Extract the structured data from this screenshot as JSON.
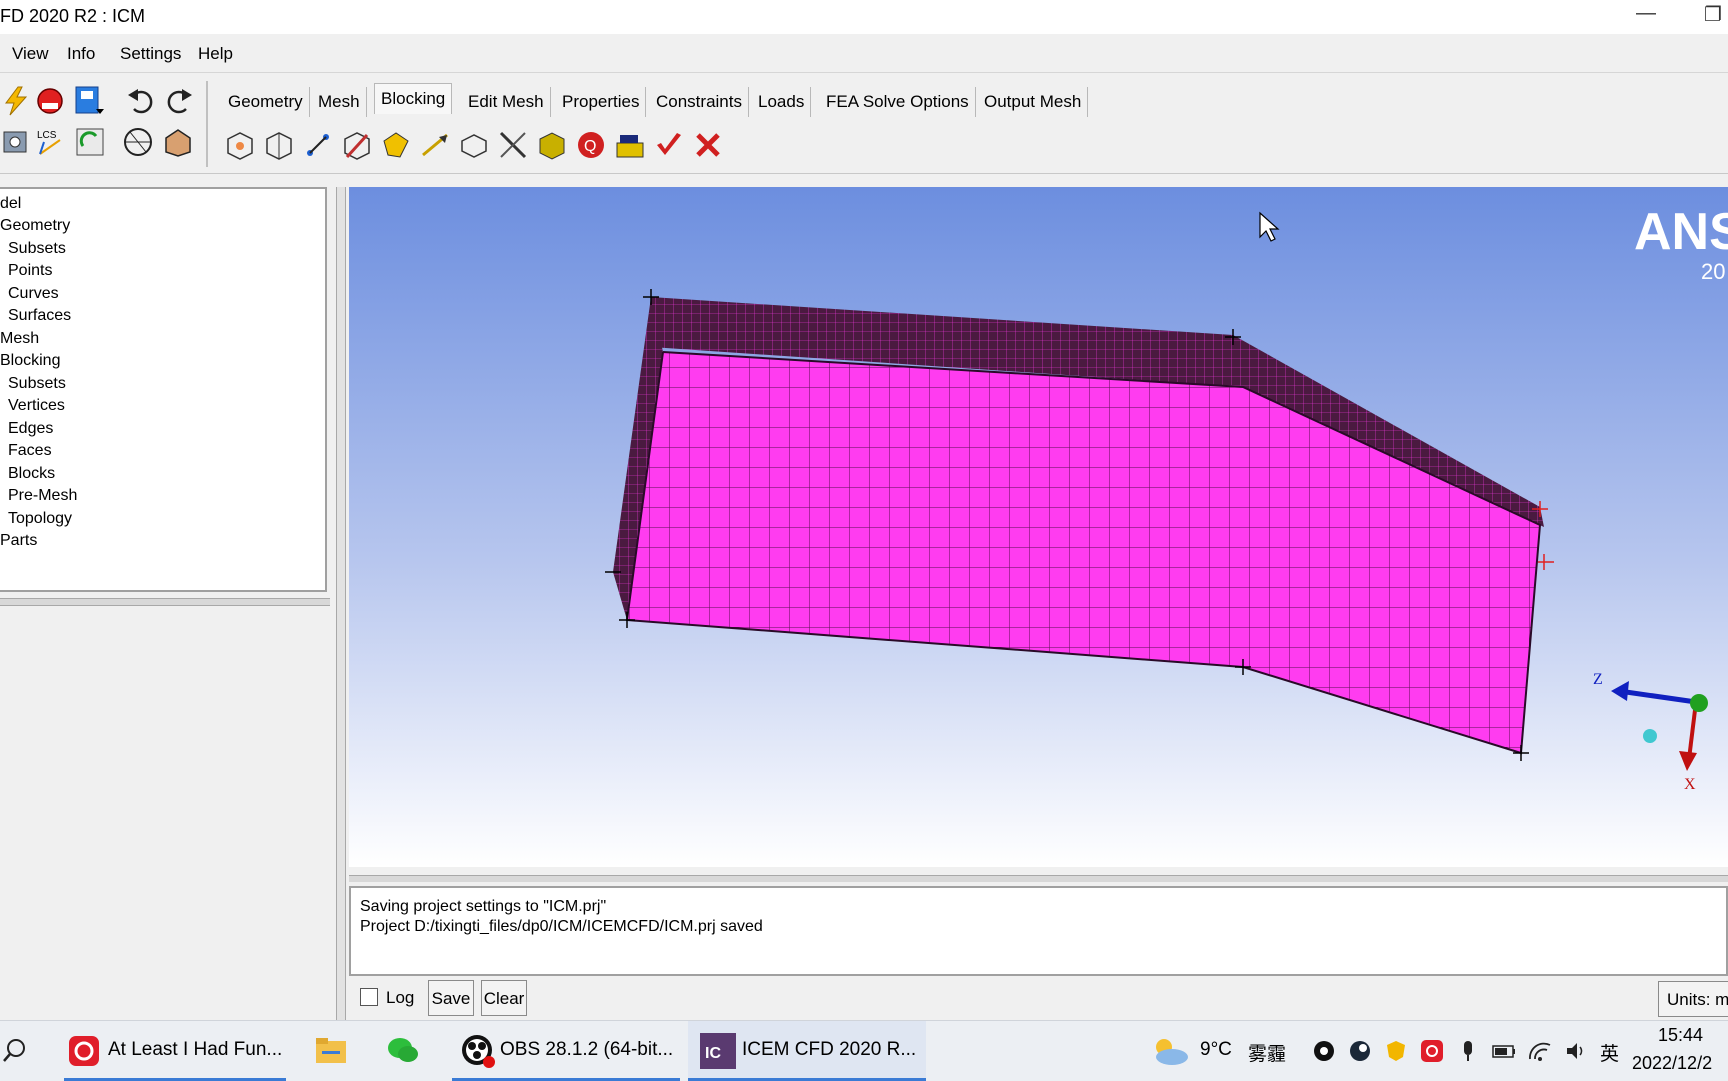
{
  "window": {
    "title": "FD 2020 R2 : ICM"
  },
  "menu": [
    "View",
    "Info",
    "Settings",
    "Help"
  ],
  "tabs": [
    {
      "label": "Geometry",
      "active": false
    },
    {
      "label": "Mesh",
      "active": false
    },
    {
      "label": "Blocking",
      "active": true
    },
    {
      "label": "Edit Mesh",
      "active": false
    },
    {
      "label": "Properties",
      "active": false
    },
    {
      "label": "Constraints",
      "active": false
    },
    {
      "label": "Loads",
      "active": false
    },
    {
      "label": "FEA Solve Options",
      "active": false
    },
    {
      "label": "Output Mesh",
      "active": false
    }
  ],
  "tree": [
    "del",
    "Geometry",
    "Subsets",
    "Points",
    "Curves",
    "Surfaces",
    "Mesh",
    "Blocking",
    "Subsets",
    "Vertices",
    "Edges",
    "Faces",
    "Blocks",
    "Pre-Mesh",
    "Topology",
    "Parts"
  ],
  "viewport": {
    "logo": "ANS",
    "logo_year": "20",
    "axis_labels": {
      "z": "Z",
      "x": "X"
    },
    "colors": {
      "mesh_face": "#ff3cf0",
      "mesh_dark": "#4a1a40",
      "bg_top": "#6c8edf",
      "bg_bottom": "#ffffff"
    }
  },
  "messages": [
    "Saving project settings to \"ICM.prj\"",
    "Project D:/tixingti_files/dp0/ICM/ICEMCFD/ICM.prj saved"
  ],
  "bottom": {
    "log_label": "Log",
    "log_checked": false,
    "save_label": "Save",
    "clear_label": "Clear",
    "units_label": "Units: mi"
  },
  "taskbar": {
    "tasks": [
      {
        "label": "At Least I Had Fun..."
      },
      {
        "label": "OBS 28.1.2 (64-bit..."
      },
      {
        "label": "ICEM CFD 2020 R..."
      }
    ],
    "weather": "9°C",
    "weather_text": "雾霾",
    "ime": "英",
    "time": "15:44",
    "date": "2022/12/2"
  },
  "icons": [
    "lightning-icon",
    "record-icon",
    "save-dropdown-icon",
    "undo-icon",
    "redo-icon",
    "search-icon",
    "folder-icon",
    "wechat-icon"
  ]
}
